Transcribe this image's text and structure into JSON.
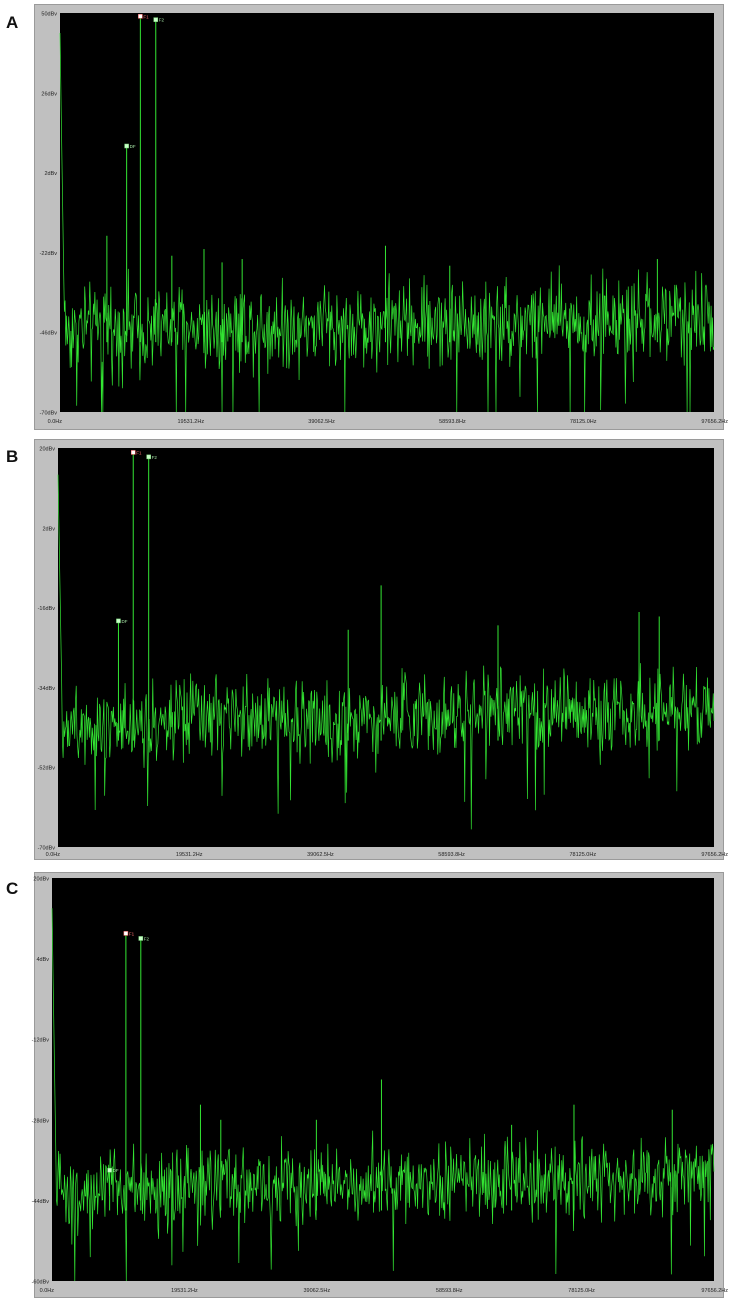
{
  "panels": [
    {
      "letter": "A"
    },
    {
      "letter": "B"
    },
    {
      "letter": "C"
    }
  ],
  "colors": {
    "trace": "#33e633",
    "plot_background": "#000000",
    "frame": "#c0c0c0",
    "marker_f1": "#ffffff",
    "marker_other": "#c8ffc8"
  },
  "chart_data": [
    {
      "type": "line",
      "panel": "A",
      "ylim": [
        -70,
        50
      ],
      "yticks": [
        50,
        26,
        2,
        -22,
        -46,
        -70
      ],
      "ytick_labels": [
        "50dBv",
        "26dBv",
        "2dBv",
        "-22dBv",
        "-46dBv",
        "-70dBv"
      ],
      "xlim": [
        0,
        97656.2
      ],
      "xticks": [
        0,
        19531.2,
        39062.5,
        58593.8,
        78125.0,
        97656.2
      ],
      "xtick_labels": [
        "0.0Hz",
        "19531.2Hz",
        "39062.5Hz",
        "58593.8Hz",
        "78125.0Hz",
        "97656.2Hz"
      ],
      "noise_floor_db": -45,
      "noise_amplitude_db": 10,
      "peaks": [
        {
          "x": 9950,
          "y": 10,
          "marker": "DF"
        },
        {
          "x": 12000,
          "y": 49,
          "marker": "F1"
        },
        {
          "x": 14300,
          "y": 48,
          "marker": "F2"
        },
        {
          "x": 7000,
          "y": -17
        },
        {
          "x": 16700,
          "y": -23
        },
        {
          "x": 21500,
          "y": -21
        },
        {
          "x": 24200,
          "y": -25
        },
        {
          "x": 27200,
          "y": -24
        },
        {
          "x": 48600,
          "y": -20
        },
        {
          "x": 58200,
          "y": -26
        },
        {
          "x": 89200,
          "y": -24
        }
      ]
    },
    {
      "type": "line",
      "panel": "B",
      "ylim": [
        -70,
        20
      ],
      "yticks": [
        20,
        2,
        -16,
        -34,
        -52,
        -70
      ],
      "ytick_labels": [
        "20dBv",
        "2dBv",
        "-16dBv",
        "-34dBv",
        "-52dBv",
        "-70dBv"
      ],
      "xlim": [
        0,
        97656.2
      ],
      "xticks": [
        0,
        19531.2,
        39062.5,
        58593.8,
        78125.0,
        97656.2
      ],
      "xtick_labels": [
        "0.0Hz",
        "19531.2Hz",
        "39062.5Hz",
        "58593.8Hz",
        "78125.0Hz",
        "97656.2Hz"
      ],
      "noise_floor_db": -42,
      "noise_amplitude_db": 7,
      "peaks": [
        {
          "x": 9000,
          "y": -19,
          "marker": "DF"
        },
        {
          "x": 11200,
          "y": 19,
          "marker": "F1"
        },
        {
          "x": 13500,
          "y": 18,
          "marker": "F2"
        },
        {
          "x": 48100,
          "y": -11
        },
        {
          "x": 43200,
          "y": -21
        },
        {
          "x": 65500,
          "y": -20
        },
        {
          "x": 86500,
          "y": -17
        },
        {
          "x": 89500,
          "y": -18
        }
      ]
    },
    {
      "type": "line",
      "panel": "C",
      "ylim": [
        -60,
        20
      ],
      "yticks": [
        20,
        4,
        -12,
        -28,
        -44,
        -60
      ],
      "ytick_labels": [
        "20dBv",
        "4dBv",
        "-12dBv",
        "-28dBv",
        "-44dBv",
        "-60dBv"
      ],
      "xlim": [
        0,
        97656.2
      ],
      "xticks": [
        0,
        19531.2,
        39062.5,
        58593.8,
        78125.0,
        97656.2
      ],
      "xtick_labels": [
        "0.0Hz",
        "19531.2Hz",
        "39062.5Hz",
        "58593.8Hz",
        "78125.0Hz",
        "97656.2Hz"
      ],
      "noise_floor_db": -42,
      "noise_amplitude_db": 6,
      "peaks": [
        {
          "x": 8500,
          "y": -38,
          "marker": "DF"
        },
        {
          "x": 10900,
          "y": 9,
          "marker": "F1"
        },
        {
          "x": 13100,
          "y": 8,
          "marker": "F2"
        },
        {
          "x": 21900,
          "y": -25
        },
        {
          "x": 24900,
          "y": -28
        },
        {
          "x": 39000,
          "y": -28
        },
        {
          "x": 48600,
          "y": -20
        },
        {
          "x": 67800,
          "y": -29
        },
        {
          "x": 77000,
          "y": -25
        },
        {
          "x": 91500,
          "y": -26
        }
      ]
    }
  ]
}
